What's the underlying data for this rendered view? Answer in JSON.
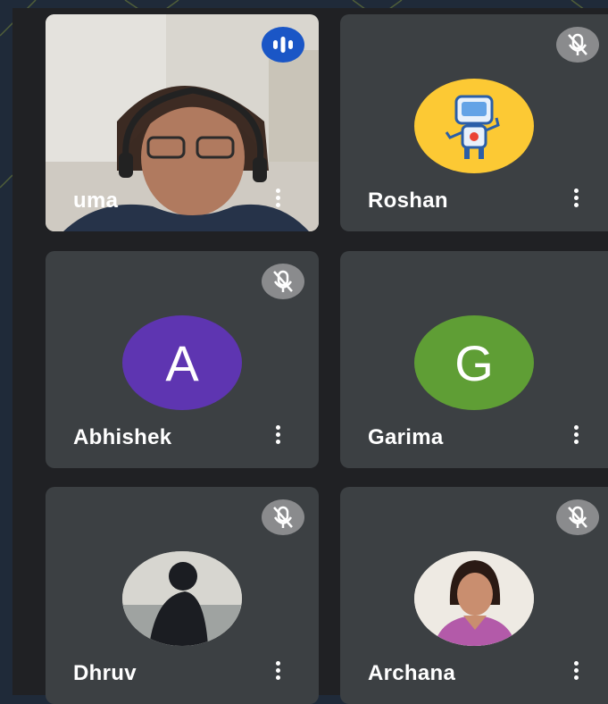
{
  "participants": [
    {
      "name": "uma",
      "avatar_type": "video",
      "speaking": true,
      "muted": false
    },
    {
      "name": "Roshan",
      "avatar_type": "robot-image",
      "avatar_color": "#fcc934",
      "muted": true
    },
    {
      "name": "Abhishek",
      "avatar_type": "letter",
      "letter": "A",
      "avatar_color": "#5e35b1",
      "muted": true
    },
    {
      "name": "Garima",
      "avatar_type": "letter",
      "letter": "G",
      "avatar_color": "#5f9e35",
      "muted": true
    },
    {
      "name": "Dhruv",
      "avatar_type": "photo",
      "muted": true
    },
    {
      "name": "Archana",
      "avatar_type": "photo",
      "muted": true
    }
  ],
  "icons": {
    "more": "more-vert-icon",
    "muted": "mic-off-icon",
    "speaking": "audio-wave-icon"
  },
  "colors": {
    "tile": "#3c4043",
    "panel": "#202124",
    "speaking_badge": "#1a56c6",
    "muted_badge": "#8a8b8d"
  }
}
